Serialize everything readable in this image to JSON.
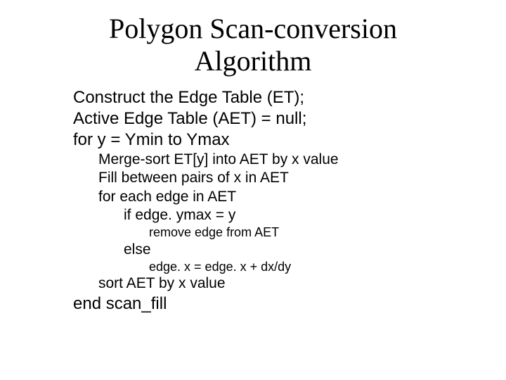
{
  "title": {
    "line1": "Polygon Scan-conversion",
    "line2": "Algorithm"
  },
  "lines": {
    "l1": "Construct the Edge Table (ET);",
    "l2": "Active Edge Table (AET) = null;",
    "l3": "for y = Ymin to Ymax",
    "l4": "Merge-sort ET[y] into AET by x value",
    "l5": "Fill between pairs of x in AET",
    "l6": "for each edge in AET",
    "l7": "if edge. ymax = y",
    "l8": "remove edge from AET",
    "l9": "else",
    "l10": "edge. x = edge. x + dx/dy",
    "l11": "sort AET by x value",
    "l12": "end scan_fill"
  }
}
